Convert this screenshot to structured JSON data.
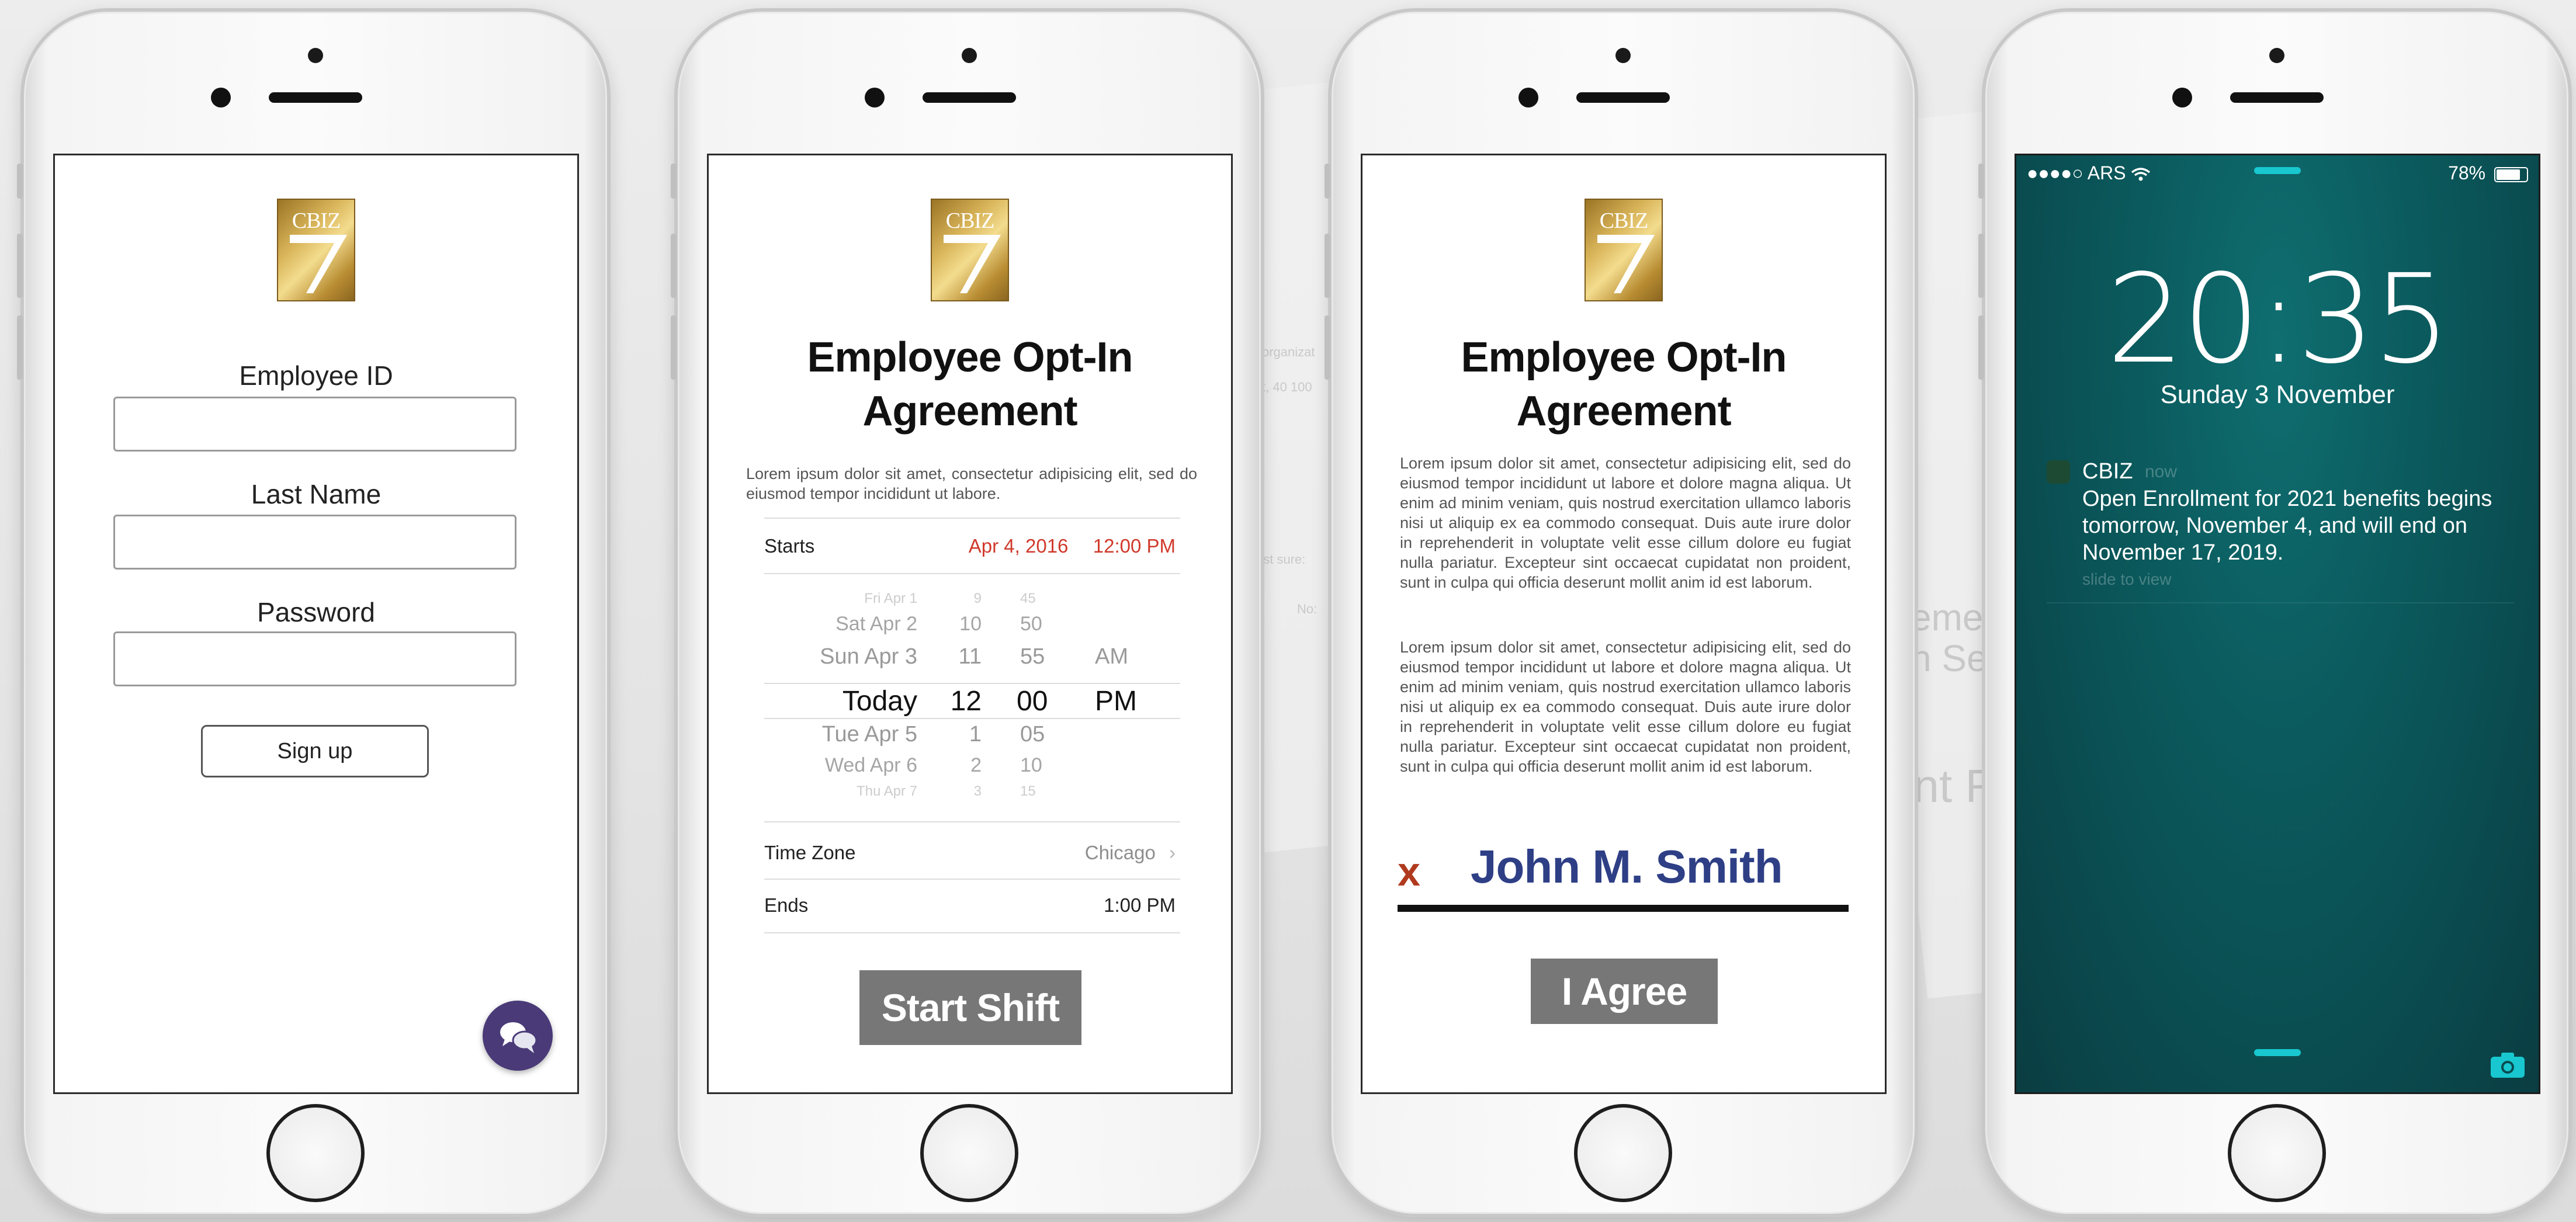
{
  "brand": {
    "logo_text": "CBIZ",
    "gold": "#d9b55a",
    "accent_purple": "#4a3a78"
  },
  "background": {
    "texts": [
      "organizat",
      "t, 40 100",
      "ust sure:",
      "No:",
      "eme",
      "n Ser",
      "ent R"
    ]
  },
  "login": {
    "employee_id_label": "Employee ID",
    "last_name_label": "Last Name",
    "password_label": "Password",
    "employee_id_value": "",
    "last_name_value": "",
    "password_value": "",
    "signup_label": "Sign up",
    "chat_icon": "chat-bubbles-icon"
  },
  "shift": {
    "title_line1": "Employee Opt-In",
    "title_line2": "Agreement",
    "intro": "Lorem ipsum dolor sit amet, consectetur adipisicing elit, sed do eiusmod tempor incididunt ut labore.",
    "starts_label": "Starts",
    "starts_date": "Apr 4, 2016",
    "starts_time": "12:00 PM",
    "picker": {
      "days": [
        "Fri Apr 1",
        "Sat Apr 2",
        "Sun Apr 3",
        "Today",
        "Tue Apr 5",
        "Wed Apr 6",
        "Thu Apr 7"
      ],
      "hours": [
        "9",
        "10",
        "11",
        "12",
        "1",
        "2",
        "3"
      ],
      "minutes": [
        "45",
        "50",
        "55",
        "00",
        "05",
        "10",
        "15"
      ],
      "ampm": [
        "",
        "",
        "AM",
        "PM",
        "",
        "",
        ""
      ]
    },
    "timezone_label": "Time Zone",
    "timezone_value": "Chicago",
    "ends_label": "Ends",
    "ends_value": "1:00 PM",
    "start_button": "Start Shift"
  },
  "agreement": {
    "title_line1": "Employee Opt-In",
    "title_line2": "Agreement",
    "paragraph1": "Lorem ipsum dolor sit amet, consectetur adipisicing elit, sed do eiusmod tempor incididunt ut labore et dolore magna aliqua. Ut enim ad minim veniam, quis nostrud exercitation ullamco laboris nisi ut aliquip ex ea commodo consequat. Duis aute irure dolor in reprehenderit in voluptate velit esse cillum dolore eu fugiat nulla pariatur. Excepteur sint occaecat cupidatat non proident, sunt in culpa qui officia deserunt mollit anim id est laborum.",
    "paragraph2": "Lorem ipsum dolor sit amet, consectetur adipisicing elit, sed do eiusmod tempor incididunt ut labore et dolore magna aliqua. Ut enim ad minim veniam, quis nostrud exercitation ullamco laboris nisi ut aliquip ex ea commodo consequat. Duis aute irure dolor in reprehenderit in voluptate velit esse cillum dolore eu fugiat nulla pariatur. Excepteur sint occaecat cupidatat non proident, sunt in culpa qui officia deserunt mollit anim id est laborum.",
    "signature_mark": "x",
    "signature_name": "John M. Smith",
    "agree_button": "I Agree"
  },
  "lockscreen": {
    "carrier": "●●●●○ ARS",
    "battery": "78%",
    "time": "20:35",
    "date": "Sunday 3 November",
    "notif_app": "CBIZ",
    "notif_time": "now",
    "notif_body": "Open Enrollment for 2021 benefits begins tomorrow, November 4, and will end on November 17, 2019.",
    "notif_slide": "slide to view",
    "camera_icon": "camera-icon",
    "wifi_icon": "wifi-icon",
    "battery_icon": "battery-icon"
  }
}
